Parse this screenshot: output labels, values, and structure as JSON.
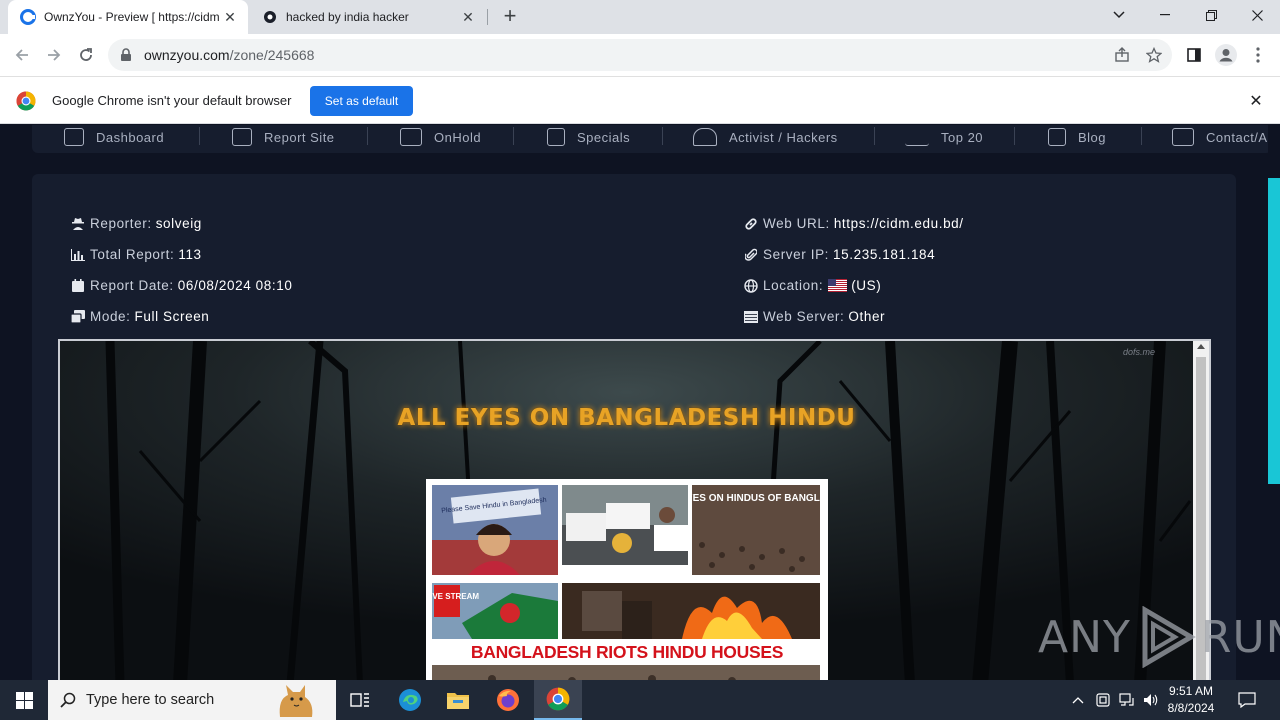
{
  "browser": {
    "tabs": [
      {
        "title": "OwnzYou - Preview [ https://cidm",
        "active": true
      },
      {
        "title": "hacked by india hacker",
        "active": false
      }
    ],
    "url_host": "ownzyou.com",
    "url_path": "/zone/245668"
  },
  "infobar": {
    "message": "Google Chrome isn't your default browser",
    "button": "Set as default"
  },
  "site_nav": [
    {
      "label": "Dashboard",
      "icon": "home-icon"
    },
    {
      "label": "Report Site",
      "icon": "plus-square-icon"
    },
    {
      "label": "OnHold",
      "icon": "envelope-icon"
    },
    {
      "label": "Specials",
      "icon": "square-icon"
    },
    {
      "label": "Activist / Hackers",
      "icon": "users-icon"
    },
    {
      "label": "Top 20",
      "icon": "trend-icon"
    },
    {
      "label": "Blog",
      "icon": "document-icon"
    },
    {
      "label": "Contact/A",
      "icon": "mail-icon"
    }
  ],
  "report": {
    "reporter_label": "Reporter:",
    "reporter": "solveig",
    "total_label": "Total Report:",
    "total": "113",
    "date_label": "Report Date:",
    "date": "06/08/2024 08:10",
    "mode_label": "Mode:",
    "mode": "Full Screen",
    "weburl_label": "Web URL:",
    "weburl": "https://cidm.edu.bd/",
    "serverip_label": "Server IP:",
    "serverip": "15.235.181.184",
    "location_label": "Location:",
    "location": "(US)",
    "webserver_label": "Web Server:",
    "webserver": "Other"
  },
  "preview": {
    "headline": "ALL EYES ON BANGLADESH HINDU",
    "corner_mark": "dofs.me",
    "collage_caption": "BANGLADESH RIOTS HINDU HOUSES BURNED",
    "sign1": "Please Save Hindu in Bangladesh",
    "sign3": "ALL EYES ON HINDUS OF BANGLADESH",
    "badge": "R. LIVE STREAM"
  },
  "watermark": {
    "left": "ANY",
    "right": "RUN"
  },
  "taskbar": {
    "search_placeholder": "Type here to search",
    "time": "9:51 AM",
    "date": "8/8/2024"
  },
  "colors": {
    "accent_cyan": "#19c6d6",
    "headline_orange": "#e8a325",
    "chrome_blue": "#1a73e8",
    "caption_red": "#d4121b"
  }
}
